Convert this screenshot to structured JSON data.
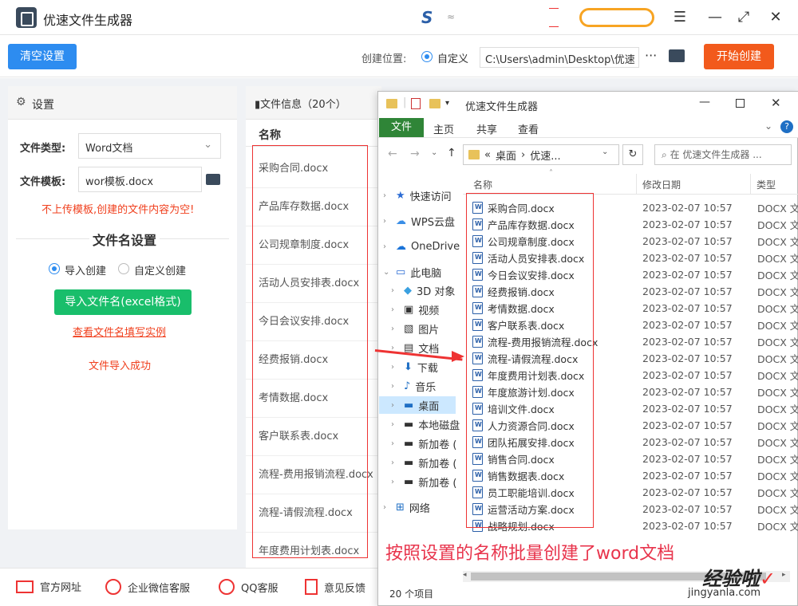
{
  "app": {
    "title": "优速文件生成器"
  },
  "toolbar": {
    "clear_label": "清空设置",
    "location_label": "创建位置:",
    "custom_label": "自定义",
    "path_value": "C:\\Users\\admin\\Desktop\\优速",
    "start_label": "开始创建"
  },
  "settings": {
    "header": "设置",
    "file_type_label": "文件类型:",
    "file_type_value": "Word文档",
    "template_label": "文件模板:",
    "template_value": "wor模板.docx",
    "warning": "不上传模板,创建的文件内容为空!",
    "filename_section": "文件名设置",
    "import_create": "导入创建",
    "custom_create": "自定义创建",
    "import_button": "导入文件名(excel格式)",
    "example_link": "查看文件名填写实例",
    "import_success": "文件导入成功"
  },
  "info": {
    "header": "文件信息（20个）",
    "col_name": "名称",
    "files": [
      "采购合同.docx",
      "产品库存数据.docx",
      "公司规章制度.docx",
      "活动人员安排表.docx",
      "今日会议安排.docx",
      "经费报销.docx",
      "考情数据.docx",
      "客户联系表.docx",
      "流程-费用报销流程.docx",
      "流程-请假流程.docx",
      "年度费用计划表.docx"
    ]
  },
  "footer": {
    "website": "官方网址",
    "wechat": "企业微信客服",
    "qq": "QQ客服",
    "feedback": "意见反馈"
  },
  "explorer": {
    "title": "优速文件生成器",
    "ribbon_tabs": [
      "文件",
      "主页",
      "共享",
      "查看"
    ],
    "address_prefix": "«",
    "address_parts": [
      "桌面",
      "优速..."
    ],
    "search_placeholder": "在 优速文件生成器 ...",
    "col_name": "名称",
    "col_date": "修改日期",
    "col_type": "类型",
    "nav": [
      "快速访问",
      "WPS云盘",
      "OneDrive",
      "此电脑",
      "3D 对象",
      "视频",
      "图片",
      "文档",
      "下载",
      "音乐",
      "桌面",
      "本地磁盘",
      "新加卷 (",
      "新加卷 (",
      "新加卷 (",
      "网络"
    ],
    "files": [
      "采购合同.docx",
      "产品库存数据.docx",
      "公司规章制度.docx",
      "活动人员安排表.docx",
      "今日会议安排.docx",
      "经费报销.docx",
      "考情数据.docx",
      "客户联系表.docx",
      "流程-费用报销流程.docx",
      "流程-请假流程.docx",
      "年度费用计划表.docx",
      "年度旅游计划.docx",
      "培训文件.docx",
      "人力资源合同.docx",
      "团队拓展安排.docx",
      "销售合同.docx",
      "销售数据表.docx",
      "员工职能培训.docx",
      "运营活动方案.docx",
      "战略规划.docx"
    ],
    "file_date": "2023-02-07 10:57",
    "file_type": "DOCX 文",
    "status": "20 个项目",
    "caption": "按照设置的名称批量创建了word文档"
  },
  "watermark": {
    "line1": "经验啦",
    "line2": "jingyanla.com"
  },
  "colors": {
    "primary": "#2d8cf0",
    "start": "#f25a1c",
    "import": "#19be6b",
    "warn": "#f0401e"
  }
}
